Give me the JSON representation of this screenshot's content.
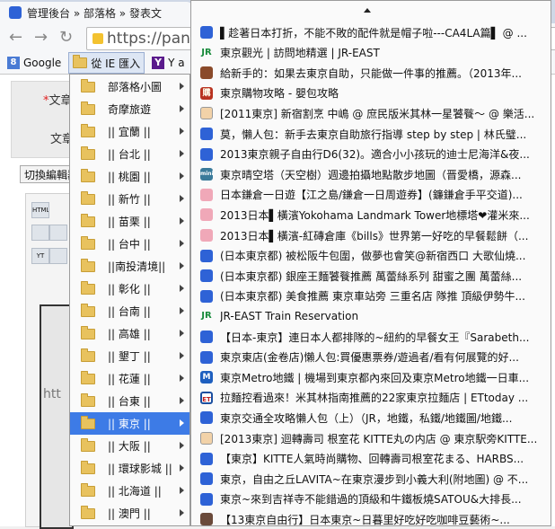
{
  "browser": {
    "tab_title": "管理後台 » 部落格 » 發表文",
    "url": "https://pane",
    "bookmarks": [
      {
        "label": "Google",
        "icon": "google-icon"
      },
      {
        "label": "從 IE 匯入",
        "icon": "folder-icon"
      },
      {
        "label": "Y a",
        "icon": "yahoo-icon"
      }
    ]
  },
  "page": {
    "label1": "文章",
    "label2": "文章",
    "required_mark": "*",
    "switch_button": "切換編輯器",
    "editor_watermark": "htt"
  },
  "folder_menu": {
    "items": [
      {
        "label": "部落格小圖"
      },
      {
        "label": "奇摩旅遊"
      },
      {
        "label": "|| 宜蘭 ||"
      },
      {
        "label": "|| 台北 ||"
      },
      {
        "label": "|| 桃園 ||"
      },
      {
        "label": "|| 新竹 ||"
      },
      {
        "label": "|| 苗栗 ||"
      },
      {
        "label": "|| 台中 ||"
      },
      {
        "label": "||南投清境||"
      },
      {
        "label": "|| 彰化 ||"
      },
      {
        "label": "|| 台南 ||"
      },
      {
        "label": "|| 高雄 ||"
      },
      {
        "label": "|| 墾丁 ||"
      },
      {
        "label": "|| 花蓮 ||"
      },
      {
        "label": "|| 台東 ||"
      },
      {
        "label": "|| 東京 ||"
      },
      {
        "label": "|| 大阪 ||"
      },
      {
        "label": "|| 環球影城 ||"
      },
      {
        "label": "|| 北海道 ||"
      },
      {
        "label": "|| 澳門 ||"
      }
    ],
    "highlighted_index": 15
  },
  "list_menu": {
    "items": [
      {
        "icon": "blue",
        "label": "▌趁著日本打折，不能不敗的配件就是帽子啦---CA4LA篇▌ @ ..."
      },
      {
        "icon": "jr",
        "label": "東京觀光 | 訪問地精選 | JR-EAST"
      },
      {
        "icon": "img",
        "label": "給新手的：如果去東京自助，只能做一件事的推薦。（2013年..."
      },
      {
        "icon": "red",
        "label": "東京購物攻略 - 嬰包攻略"
      },
      {
        "icon": "face",
        "label": "[2011東京] 新宿割烹 中嶋 @ 庶民版米其林一星饕餮～ @ 樂活..."
      },
      {
        "icon": "blue",
        "label": "莫，懶人包：新手去東京自助旅行指導 step by step | 林氏璧..."
      },
      {
        "icon": "blue",
        "label": "2013東京親子自由行D6(32)。適合小小孩玩的迪士尼海洋&夜..."
      },
      {
        "icon": "mini",
        "label": "東京晴空塔（天空樹）週邊拍攝地點散步地圖（晋愛橋，源森..."
      },
      {
        "icon": "pink",
        "label": "日本鎌倉一日遊【江之島/鎌倉一日周遊券】(鐮鎌倉手平交道)..."
      },
      {
        "icon": "pink",
        "label": "2013日本▌橫濱Yokohama Landmark Tower地標塔❤灌米來..."
      },
      {
        "icon": "pink",
        "label": "2013日本▌橫濱-紅磚倉庫《bills》世界第一好吃的早餐鬆餅（..."
      },
      {
        "icon": "blue",
        "label": "(日本東京都) 被松阪牛包圍，做夢也會笑@新宿西口 大歌仙燒..."
      },
      {
        "icon": "blue",
        "label": "(日本東京都) 銀座王麵饕餮推薦 萬蕾絲系列 甜蜜之團 萬蕾絲..."
      },
      {
        "icon": "blue",
        "label": "(日本東京都) 美食推薦 東京車站旁 三重名店 隊推 頂級伊勢牛..."
      },
      {
        "icon": "jr",
        "label": "JR-EAST Train Reservation"
      },
      {
        "icon": "blue",
        "label": "【日本-東京】連日本人都排隊的~紐約的早餐女王『Sarabeth..."
      },
      {
        "icon": "blue",
        "label": "東京東店(金卷店)懶人包:買優惠票券/遊過者/看有何展覽的好..."
      },
      {
        "icon": "metro",
        "label": "東京Metro地鐵 | 機場到東京都內來回及東京Metro地鐵一日車..."
      },
      {
        "icon": "ettoday",
        "label": "拉麵控看過來！米其林指南推薦的22家東京拉麵店 | ETtoday ..."
      },
      {
        "icon": "blue",
        "label": "東京交通全攻略懶人包（上）（JR，地鐵，私鐵/地鐵圖/地鐵..."
      },
      {
        "icon": "face",
        "label": "[2013東京] 迴轉壽司 根室花 KITTE丸の内店 @ 東京駅旁KITTE..."
      },
      {
        "icon": "blue",
        "label": "【東京】KITTE人氣時尚購物、回轉壽司根室花まる、HARBS..."
      },
      {
        "icon": "blue",
        "label": "東京，自由之丘LAVITA~在東京漫步到小義大利(附地圖) @ 不..."
      },
      {
        "icon": "blue",
        "label": "東京~來到吉祥寺不能錯過的頂級和牛鐵板燒SATOU&大排長..."
      },
      {
        "icon": "photo",
        "label": "【13東京自由行】日本東京~日暮里好吃好吃咖啡豆藝術~..."
      }
    ]
  },
  "colors": {
    "highlight": "#3d7be6",
    "tabstrip": "#cfd8e6",
    "favicon_blue": "#2e62d6"
  }
}
